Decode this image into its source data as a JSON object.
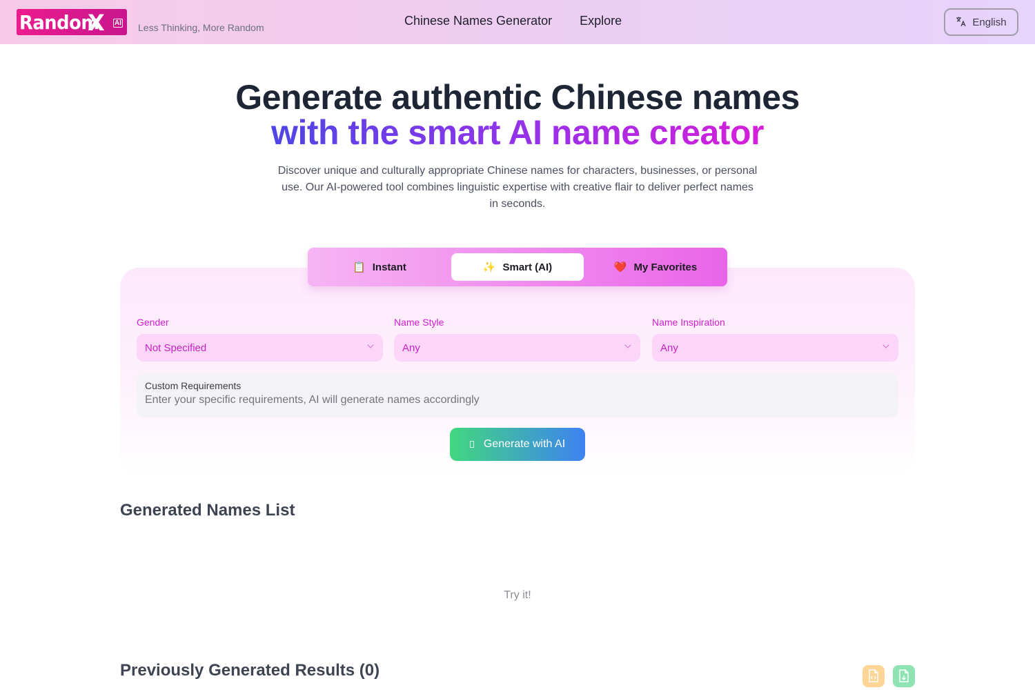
{
  "header": {
    "logo_text": "Random",
    "logo_x": "X",
    "logo_badge": "AI",
    "tagline": "Less Thinking, More Random",
    "nav": [
      {
        "label": "Chinese Names Generator"
      },
      {
        "label": "Explore"
      }
    ],
    "language": {
      "label": "English",
      "icon": "translate-icon"
    }
  },
  "hero": {
    "title_line1": "Generate authentic Chinese names",
    "title_line2": "with the smart AI name creator",
    "description": "Discover unique and culturally appropriate Chinese names for characters, businesses, or personal use. Our AI-powered tool combines linguistic expertise with creative flair to deliver perfect names in seconds."
  },
  "tabs": [
    {
      "label": "Instant",
      "icon": "📋",
      "active": false
    },
    {
      "label": "Smart (AI)",
      "icon": "✨",
      "active": true
    },
    {
      "label": "My Favorites",
      "icon": "❤️",
      "active": false
    }
  ],
  "form": {
    "gender": {
      "label": "Gender",
      "value": "Not Specified"
    },
    "name_style": {
      "label": "Name Style",
      "value": "Any"
    },
    "name_inspiration": {
      "label": "Name Inspiration",
      "value": "Any"
    },
    "custom": {
      "label": "Custom Requirements",
      "placeholder": "Enter your specific requirements, AI will generate names accordingly",
      "value": ""
    },
    "generate_label": "Generate with AI"
  },
  "generated": {
    "title": "Generated Names List",
    "empty_text": "Try it!"
  },
  "previous": {
    "title": "Previously Generated Results (0)",
    "count": 0,
    "actions": [
      {
        "name": "export-json",
        "icon": "file-code-icon",
        "color": "#fdd597"
      },
      {
        "name": "download",
        "icon": "file-download-icon",
        "color": "#8fe3b3"
      }
    ]
  }
}
